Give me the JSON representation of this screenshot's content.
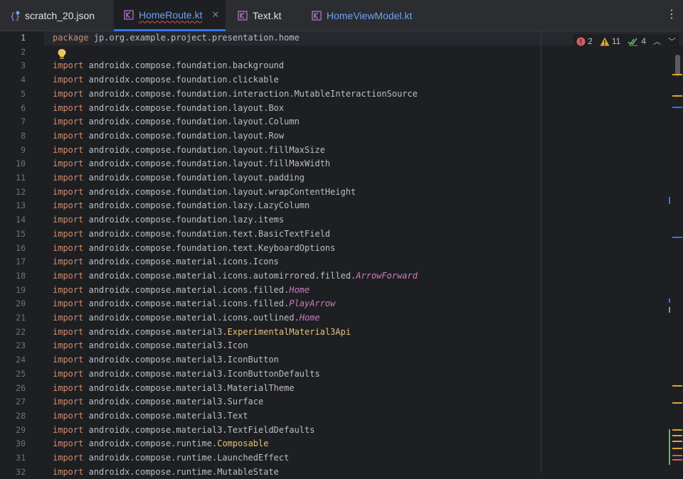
{
  "tabs": [
    {
      "label": "scratch_20.json",
      "icon": "json-file-icon",
      "active": false
    },
    {
      "label": "HomeRoute.kt",
      "icon": "kotlin-file-icon",
      "active": true
    },
    {
      "label": "Text.kt",
      "icon": "kotlin-file-icon",
      "active": false
    },
    {
      "label": "HomeViewModel.kt",
      "icon": "kotlin-file-icon",
      "active": false
    }
  ],
  "inspections": {
    "errors": "2",
    "warnings": "11",
    "ok": "4"
  },
  "lines": [
    {
      "n": "1",
      "t": [
        [
          "kw",
          "package"
        ],
        [
          "",
          "jp.org.example.project.presentation.home"
        ]
      ]
    },
    {
      "n": "2",
      "t": []
    },
    {
      "n": "3",
      "t": [
        [
          "kw",
          "import"
        ],
        [
          "",
          "androidx.compose.foundation.background"
        ]
      ]
    },
    {
      "n": "4",
      "t": [
        [
          "kw",
          "import"
        ],
        [
          "",
          "androidx.compose.foundation.clickable"
        ]
      ]
    },
    {
      "n": "5",
      "t": [
        [
          "kw",
          "import"
        ],
        [
          "",
          "androidx.compose.foundation.interaction.MutableInteractionSource"
        ]
      ]
    },
    {
      "n": "6",
      "t": [
        [
          "kw",
          "import"
        ],
        [
          "",
          "androidx.compose.foundation.layout.Box"
        ]
      ]
    },
    {
      "n": "7",
      "t": [
        [
          "kw",
          "import"
        ],
        [
          "",
          "androidx.compose.foundation.layout.Column"
        ]
      ]
    },
    {
      "n": "8",
      "t": [
        [
          "kw",
          "import"
        ],
        [
          "",
          "androidx.compose.foundation.layout.Row"
        ]
      ]
    },
    {
      "n": "9",
      "t": [
        [
          "kw",
          "import"
        ],
        [
          "",
          "androidx.compose.foundation.layout.fillMaxSize"
        ]
      ]
    },
    {
      "n": "10",
      "t": [
        [
          "kw",
          "import"
        ],
        [
          "",
          "androidx.compose.foundation.layout.fillMaxWidth"
        ]
      ]
    },
    {
      "n": "11",
      "t": [
        [
          "kw",
          "import"
        ],
        [
          "",
          "androidx.compose.foundation.layout.padding"
        ]
      ]
    },
    {
      "n": "12",
      "t": [
        [
          "kw",
          "import"
        ],
        [
          "",
          "androidx.compose.foundation.layout.wrapContentHeight"
        ]
      ]
    },
    {
      "n": "13",
      "t": [
        [
          "kw",
          "import"
        ],
        [
          "",
          "androidx.compose.foundation.lazy.LazyColumn"
        ]
      ]
    },
    {
      "n": "14",
      "t": [
        [
          "kw",
          "import"
        ],
        [
          "",
          "androidx.compose.foundation.lazy.items"
        ]
      ]
    },
    {
      "n": "15",
      "t": [
        [
          "kw",
          "import"
        ],
        [
          "",
          "androidx.compose.foundation.text.BasicTextField"
        ]
      ]
    },
    {
      "n": "16",
      "t": [
        [
          "kw",
          "import"
        ],
        [
          "",
          "androidx.compose.foundation.text.KeyboardOptions"
        ]
      ]
    },
    {
      "n": "17",
      "t": [
        [
          "kw",
          "import"
        ],
        [
          "",
          "androidx.compose.material.icons.Icons"
        ]
      ]
    },
    {
      "n": "18",
      "t": [
        [
          "kw",
          "import"
        ],
        [
          "",
          "androidx.compose.material.icons.automirrored.filled."
        ],
        [
          "italic",
          "ArrowForward"
        ]
      ]
    },
    {
      "n": "19",
      "t": [
        [
          "kw",
          "import"
        ],
        [
          "",
          "androidx.compose.material.icons.filled."
        ],
        [
          "italic",
          "Home"
        ]
      ]
    },
    {
      "n": "20",
      "t": [
        [
          "kw",
          "import"
        ],
        [
          "",
          "androidx.compose.material.icons.filled."
        ],
        [
          "italic",
          "PlayArrow"
        ]
      ]
    },
    {
      "n": "21",
      "t": [
        [
          "kw",
          "import"
        ],
        [
          "",
          "androidx.compose.material.icons.outlined."
        ],
        [
          "italic",
          "Home"
        ]
      ]
    },
    {
      "n": "22",
      "t": [
        [
          "kw",
          "import"
        ],
        [
          "",
          "androidx.compose.material3."
        ],
        [
          "yellowname",
          "ExperimentalMaterial3Api"
        ]
      ]
    },
    {
      "n": "23",
      "t": [
        [
          "kw",
          "import"
        ],
        [
          "",
          "androidx.compose.material3.Icon"
        ]
      ]
    },
    {
      "n": "24",
      "t": [
        [
          "kw",
          "import"
        ],
        [
          "",
          "androidx.compose.material3.IconButton"
        ]
      ]
    },
    {
      "n": "25",
      "t": [
        [
          "kw",
          "import"
        ],
        [
          "",
          "androidx.compose.material3.IconButtonDefaults"
        ]
      ]
    },
    {
      "n": "26",
      "t": [
        [
          "kw",
          "import"
        ],
        [
          "",
          "androidx.compose.material3.MaterialTheme"
        ]
      ]
    },
    {
      "n": "27",
      "t": [
        [
          "kw",
          "import"
        ],
        [
          "",
          "androidx.compose.material3.Surface"
        ]
      ]
    },
    {
      "n": "28",
      "t": [
        [
          "kw",
          "import"
        ],
        [
          "",
          "androidx.compose.material3.Text"
        ]
      ]
    },
    {
      "n": "29",
      "t": [
        [
          "kw",
          "import"
        ],
        [
          "",
          "androidx.compose.material3.TextFieldDefaults"
        ]
      ]
    },
    {
      "n": "30",
      "t": [
        [
          "kw",
          "import"
        ],
        [
          "",
          "androidx.compose.runtime."
        ],
        [
          "yellowname",
          "Composable"
        ]
      ]
    },
    {
      "n": "31",
      "t": [
        [
          "kw",
          "import"
        ],
        [
          "",
          "androidx.compose.runtime.LaunchedEffect"
        ]
      ]
    },
    {
      "n": "32",
      "t": [
        [
          "kw",
          "import"
        ],
        [
          "",
          "androidx.compose.runtime.MutableState"
        ]
      ]
    }
  ],
  "colors": {
    "keyword": "#cf8e6d",
    "italic_ref": "#c77dbb",
    "annotation": "#e5c07b",
    "accent": "#3574f0",
    "error": "#db5c5c",
    "warning": "#e0a431",
    "ok": "#5fb865"
  }
}
